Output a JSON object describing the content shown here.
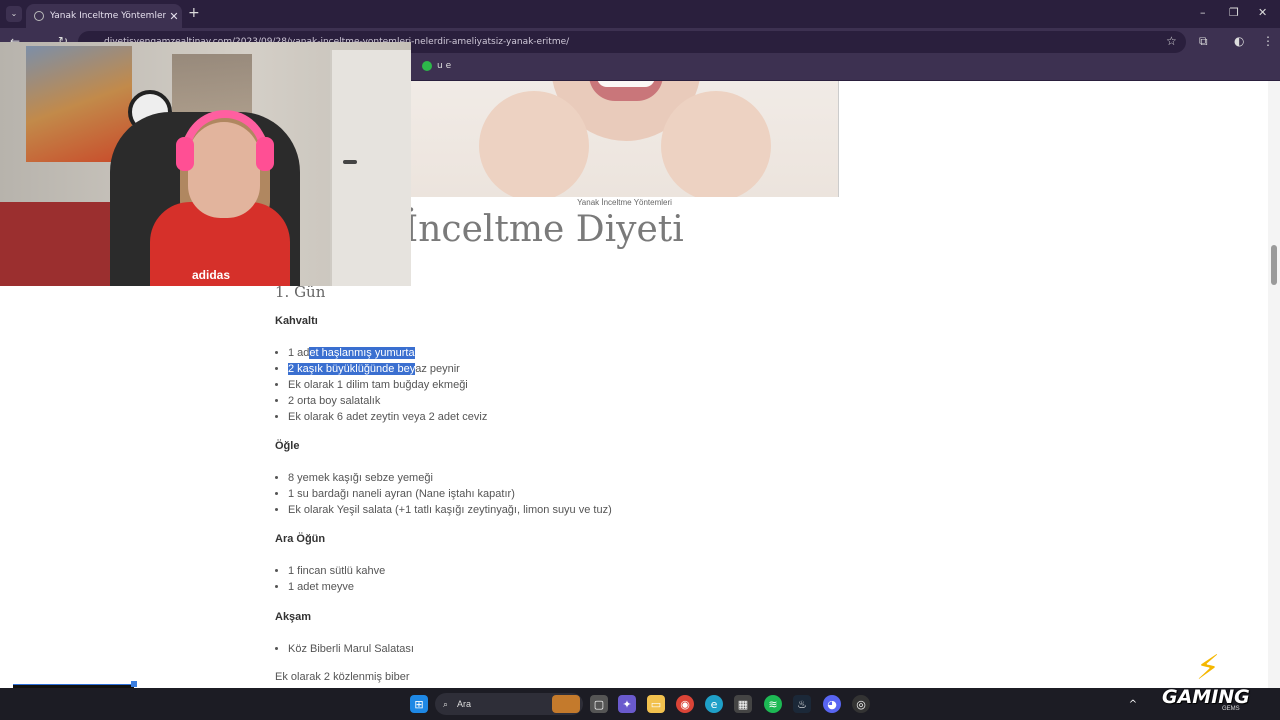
{
  "browser": {
    "tab_title": "Yanak İnceltme Yöntemleri Nele",
    "url": "diyetisyengamzealtinay.com/2023/09/28/yanak-inceltme-yontemleri-nelerdir-ameliyatsiz-yanak-eritme/",
    "bookmark_label": "u e"
  },
  "article": {
    "image_caption": "Yanak İnceltme Yöntemleri",
    "heading": "İnceltme Diyeti",
    "day_heading": "1. Gün",
    "sections": [
      {
        "title": "Kahvaltı",
        "items": [
          {
            "pre": "1 ad",
            "sel": "et haşlanmış yumurta",
            "post": ""
          },
          {
            "pre": "",
            "sel": "2 kaşık büyüklüğünde bey",
            "post": "az peynir"
          },
          {
            "pre": "Ek olarak 1 dilim tam buğday ekmeği",
            "sel": "",
            "post": ""
          },
          {
            "pre": "2 orta boy salatalık",
            "sel": "",
            "post": ""
          },
          {
            "pre": "Ek olarak 6 adet zeytin veya 2 adet ceviz",
            "sel": "",
            "post": ""
          }
        ]
      },
      {
        "title": "Öğle",
        "items": [
          "8 yemek kaşığı sebze yemeği",
          "1 su bardağı naneli ayran (Nane iştahı kapatır)",
          "Ek olarak Yeşil salata (+1 tatlı kaşığı zeytinyağı, limon suyu ve tuz)"
        ]
      },
      {
        "title": "Ara Öğün",
        "items": [
          "1 fincan sütlü kahve",
          "1 adet meyve"
        ]
      },
      {
        "title": "Akşam",
        "items": [
          "Köz Biberli Marul Salatası"
        ]
      }
    ],
    "trailing_text": "Ek olarak 2 közlenmiş biber"
  },
  "webcam": {
    "shirt_text": "adidas"
  },
  "taskbar": {
    "search_label": "Ara"
  },
  "overlay": {
    "logo_text": "GAMING",
    "logo_subtext": "GEMS"
  }
}
